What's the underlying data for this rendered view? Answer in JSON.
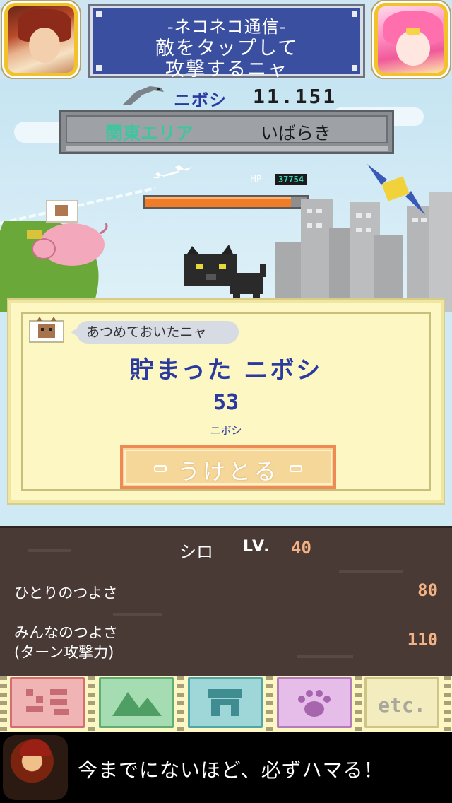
{
  "header": {
    "news_title": "-ネコネコ通信-",
    "news_line1": "敵をタップして",
    "news_line2": "攻撃するニャ",
    "left_avatar": "hero-portrait",
    "right_avatar": "princess-portrait"
  },
  "status": {
    "currency_label": "ニボシ",
    "currency_count": "11.151",
    "area_name": "関東エリア",
    "prefecture": "いばらき",
    "area_progress": 0.0,
    "hp_label": "HP",
    "hp_value": "37754",
    "hp_fill": 0.9
  },
  "popup": {
    "speech": "あつめておいたニャ",
    "heading": "貯まった ニボシ",
    "amount": "53",
    "unit": "ニボシ",
    "button_label": "うけとる"
  },
  "stats": {
    "char_name": "シロ",
    "lv_label": "LV.",
    "lv_value": "40",
    "solo_label": "ひとりのつよさ",
    "solo_value": "80",
    "team_label_line1": "みんなのつよさ",
    "team_label_line2": "(ターン攻撃力)",
    "team_value": "110"
  },
  "nav": {
    "tabs": [
      {
        "icon": "stage-icon",
        "color": "#e8969a"
      },
      {
        "icon": "mountain-icon",
        "color": "#8cc99c"
      },
      {
        "icon": "shop-icon",
        "color": "#79c2c3"
      },
      {
        "icon": "paw-icon",
        "color": "#d9a3dc"
      },
      {
        "icon": "etc-icon",
        "color": "#e6dfa8"
      }
    ],
    "etc_label": "etc."
  },
  "ad": {
    "text": "今までにないほど、必ずハマる！"
  }
}
